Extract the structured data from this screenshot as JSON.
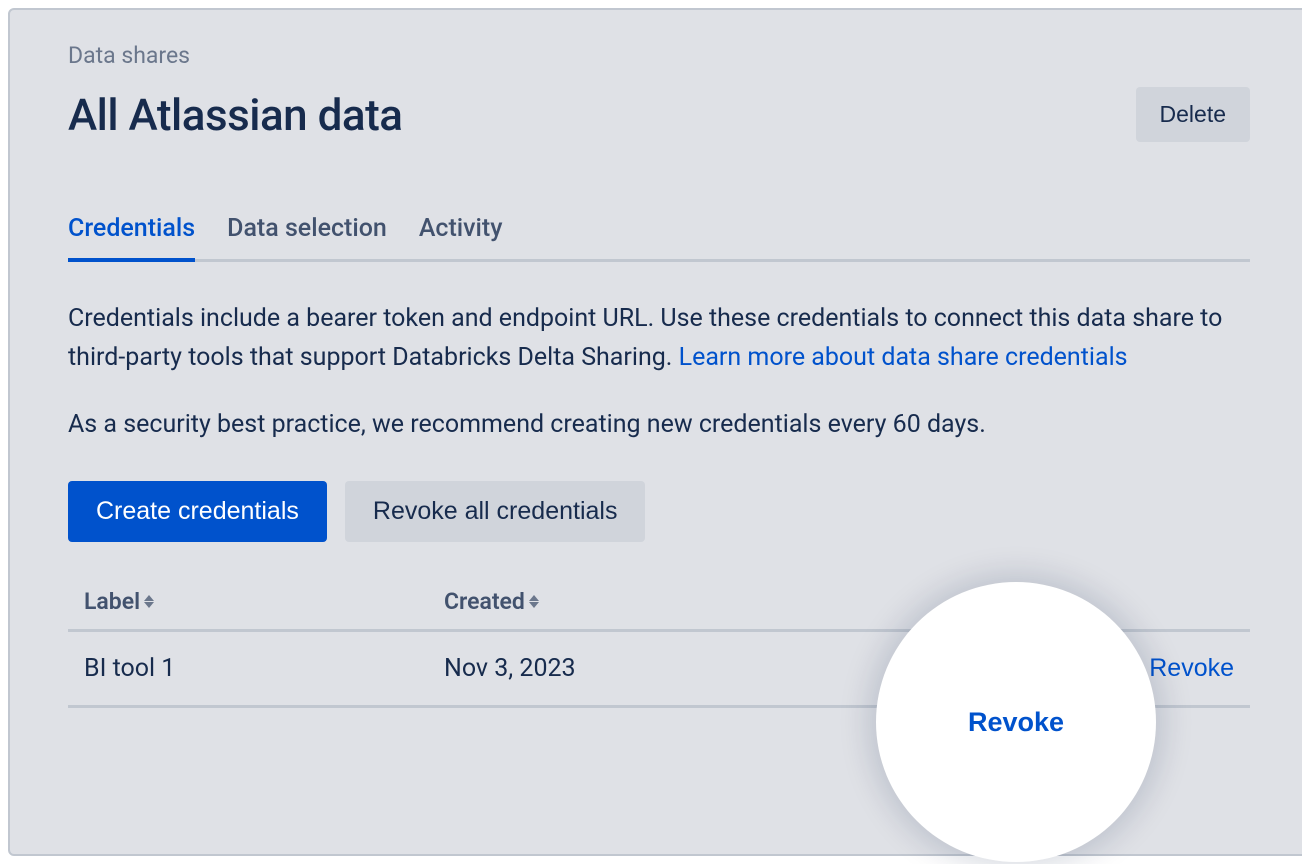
{
  "breadcrumb": "Data shares",
  "page_title": "All Atlassian data",
  "delete_button": "Delete",
  "tabs": {
    "credentials": "Credentials",
    "data_selection": "Data selection",
    "activity": "Activity"
  },
  "description": {
    "text": "Credentials include a bearer token and endpoint URL. Use these credentials to connect this data share to third-party tools that support Databricks Delta Sharing. ",
    "link_text": "Learn more about data share credentials"
  },
  "security_note": "As a security best practice, we recommend creating new credentials every 60 days.",
  "buttons": {
    "create": "Create credentials",
    "revoke_all": "Revoke all credentials"
  },
  "table": {
    "headers": {
      "label": "Label",
      "created": "Created"
    },
    "row": {
      "label": "BI tool 1",
      "created": "Nov 3, 2023",
      "action": "Revoke"
    }
  },
  "highlight_action": "Revoke"
}
